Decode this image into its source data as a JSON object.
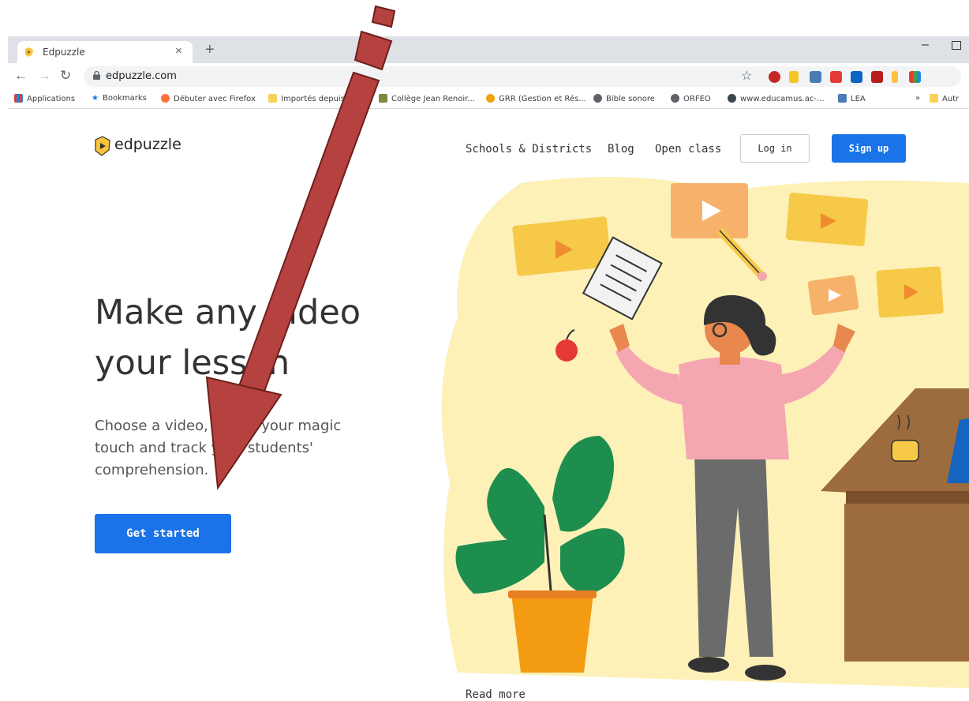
{
  "browser": {
    "tab_title": "Edpuzzle",
    "tab_close": "×",
    "new_tab": "+",
    "url": "edpuzzle.com",
    "bookmarks": [
      {
        "label": "Applications",
        "icon": "apps-grid-icon",
        "color": "#e53935"
      },
      {
        "label": "Bookmarks",
        "icon": "star-icon",
        "color": "#1a73e8"
      },
      {
        "label": "Débuter avec Firefox",
        "icon": "firefox-icon",
        "color": "#ff7139"
      },
      {
        "label": "Importés depuis",
        "icon": "folder-icon",
        "color": "#f9d25b"
      },
      {
        "label": "Collège Jean Renoir...",
        "icon": "school-icon",
        "color": "#7a8b3c"
      },
      {
        "label": "GRR (Gestion et Rés...",
        "icon": "grr-icon",
        "color": "#f0a30a"
      },
      {
        "label": "Bible sonore",
        "icon": "globe-icon",
        "color": "#5f6368"
      },
      {
        "label": "ORFEO",
        "icon": "globe-icon",
        "color": "#5f6368"
      },
      {
        "label": "www.educamus.ac-...",
        "icon": "educamus-icon",
        "color": "#37474f"
      },
      {
        "label": "LEA",
        "icon": "lea-icon",
        "color": "#4b7bb5"
      },
      {
        "label": "»",
        "icon": "overflow-icon",
        "color": "#5f6368"
      },
      {
        "label": "Autr",
        "icon": "folder-icon",
        "color": "#f9d25b"
      }
    ]
  },
  "site": {
    "logo_text": "edpuzzle",
    "nav": {
      "schools": "Schools & Districts",
      "blog": "Blog",
      "open_class": "Open class",
      "login": "Log in",
      "signup": "Sign up"
    },
    "hero": {
      "title_line1": "Make any video",
      "title_line2": "your lesson",
      "subtitle": "Choose a video, give it your magic touch and track your students' comprehension.",
      "cta": "Get started"
    },
    "read_more": "Read more"
  },
  "colors": {
    "brand_blue": "#1a73e8",
    "logo_yellow": "#f9c33c",
    "arrow_red": "#b5423f",
    "blob_yellow": "#fdf1b8"
  }
}
